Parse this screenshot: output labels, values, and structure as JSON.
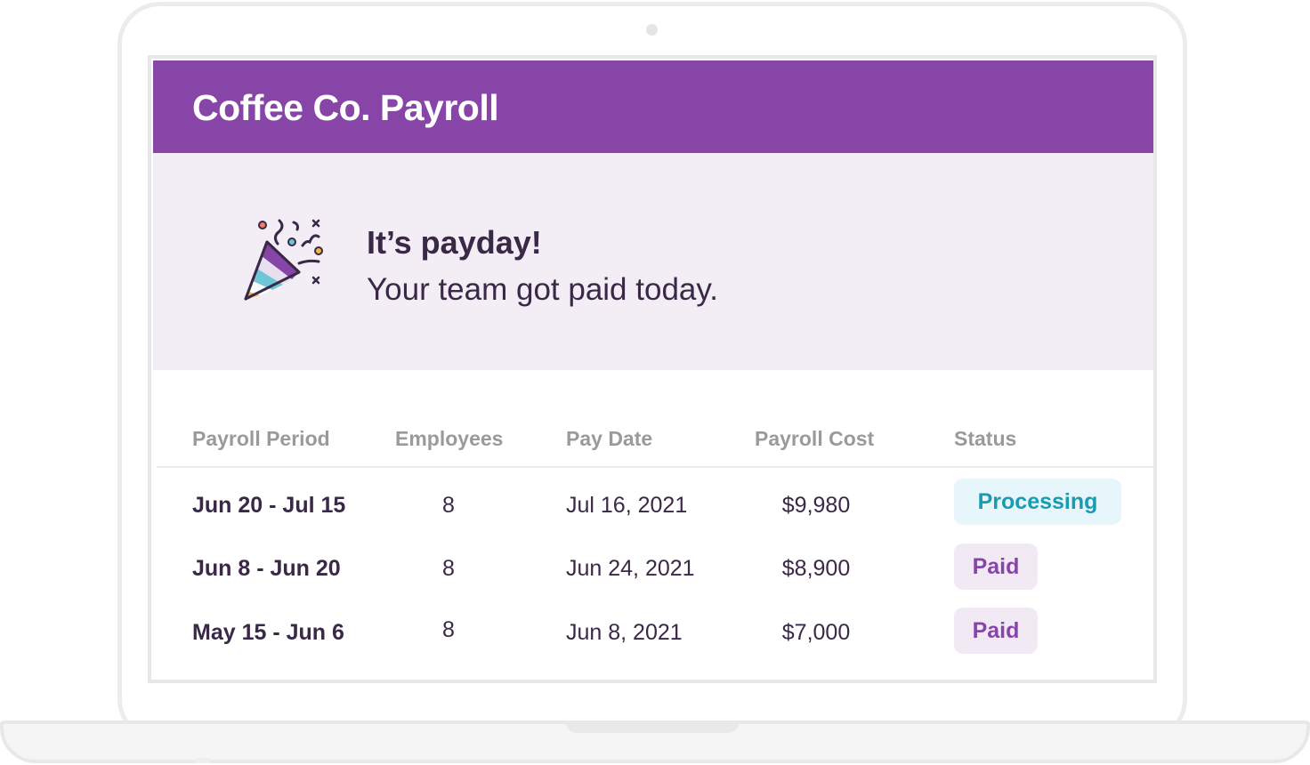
{
  "app": {
    "title": "Coffee Co. Payroll"
  },
  "banner": {
    "icon": "party-popper-icon",
    "heading": "It’s payday!",
    "message": "Your team got paid today."
  },
  "table": {
    "columns": [
      "Payroll Period",
      "Employees",
      "Pay Date",
      "Payroll Cost",
      "Status"
    ],
    "rows": [
      {
        "period": "Jun 20 - Jul 15",
        "employees": "8",
        "pay_date": "Jul 16, 2021",
        "cost": "$9,980",
        "status": "Processing"
      },
      {
        "period": "Jun 8 - Jun 20",
        "employees": "8",
        "pay_date": "Jun 24, 2021",
        "cost": "$8,900",
        "status": "Paid"
      },
      {
        "period": "May 15 - Jun 6",
        "employees": "8",
        "pay_date": "Jun 8, 2021",
        "cost": "$7,000",
        "status": "Paid"
      }
    ]
  },
  "colors": {
    "brand_purple": "#8746a7",
    "banner_bg": "#f3edf5",
    "processing_text": "#1a9bb2",
    "processing_bg": "#e6f6fb",
    "paid_bg": "#f1eaf4"
  }
}
